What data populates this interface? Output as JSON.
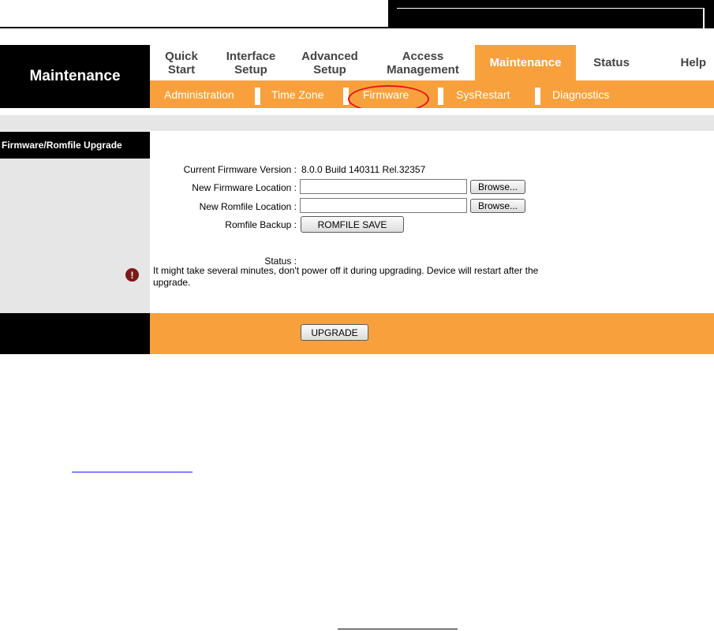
{
  "brand": "Maintenance",
  "nav": [
    {
      "label": "Quick Start"
    },
    {
      "label": "Interface Setup"
    },
    {
      "label": "Advanced Setup"
    },
    {
      "label": "Access Management"
    },
    {
      "label": "Maintenance"
    },
    {
      "label": "Status"
    },
    {
      "label": "Help"
    }
  ],
  "subnav": [
    {
      "label": "Administration"
    },
    {
      "label": "Time Zone"
    },
    {
      "label": "Firmware"
    },
    {
      "label": "SysRestart"
    },
    {
      "label": "Diagnostics"
    }
  ],
  "section_title": "Firmware/Romfile Upgrade",
  "form": {
    "current_fw_label": "Current Firmware Version :",
    "current_fw_value": "8.0.0 Build 140311 Rel.32357",
    "new_fw_label": "New Firmware Location :",
    "new_rom_label": "New Romfile Location :",
    "rom_backup_label": "Romfile Backup :",
    "browse_label": "Browse...",
    "romfile_save_label": "ROMFILE SAVE",
    "status_label": "Status :",
    "status_message": "It might take several minutes, don't power off it during upgrading. Device will restart after the upgrade."
  },
  "footer": {
    "upgrade_label": "UPGRADE"
  },
  "colors": {
    "accent": "#f8a13c",
    "dark": "#000000",
    "panel": "#e6e6e6",
    "highlight": "#e8141c"
  }
}
